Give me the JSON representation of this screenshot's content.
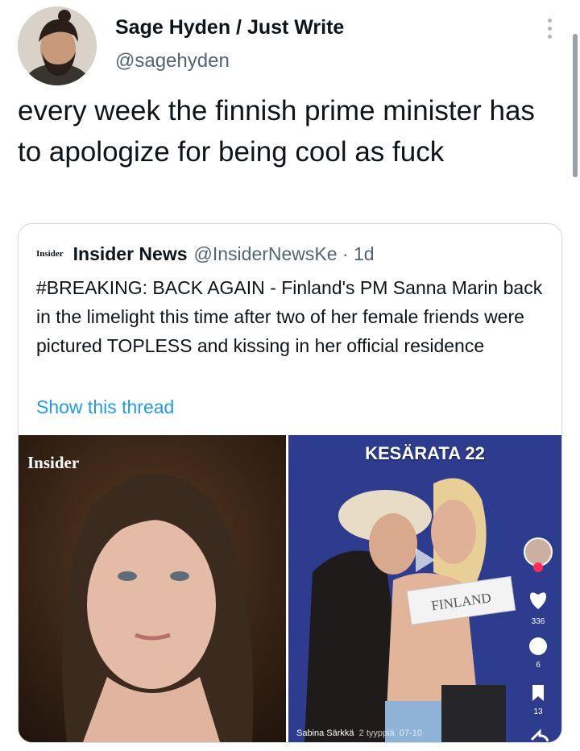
{
  "tweet": {
    "author_name": "Sage Hyden / Just Write",
    "author_handle": "@sagehyden",
    "text": "every week the finnish prime minister has to apologize for being cool as fuck"
  },
  "quoted": {
    "logo_text": "Insider",
    "author_name": "Insider News",
    "meta": "@InsiderNewsKe · 1d",
    "text": "#BREAKING: BACK AGAIN - Finland's PM Sanna Marin back in the limelight this time after two of her female friends were pictured TOPLESS and kissing in her official residence",
    "show_thread": "Show this thread",
    "media": {
      "left_watermark": "Insider",
      "right_caption": "KESÄRATA 22",
      "sign_text": "FINLAND",
      "likes": "336",
      "comments": "6",
      "saves": "13",
      "credit": "Sabina Särkkä",
      "credit_tag": "2 tyyppiä",
      "date": "07-10"
    }
  },
  "colors": {
    "text": "#0f1419",
    "secondary": "#536471",
    "link": "#1d9bf0",
    "border": "#cfd9de"
  },
  "icons": [
    "more-icon",
    "heart-icon",
    "comment-icon",
    "bookmark-icon",
    "share-icon",
    "play-icon"
  ]
}
